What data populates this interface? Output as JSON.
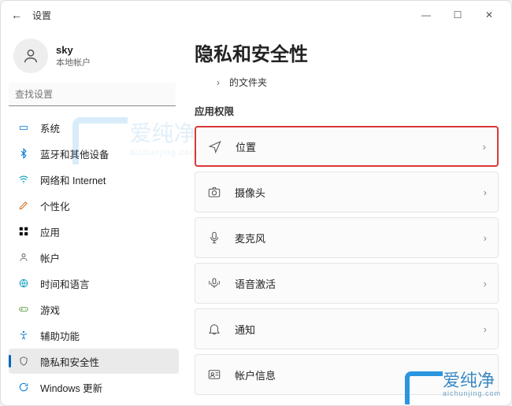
{
  "titlebar": {
    "title": "设置"
  },
  "user": {
    "name": "sky",
    "subtitle": "本地帐户"
  },
  "search": {
    "placeholder": "查找设置"
  },
  "nav": {
    "items": [
      {
        "label": "系统"
      },
      {
        "label": "蓝牙和其他设备"
      },
      {
        "label": "网络和 Internet"
      },
      {
        "label": "个性化"
      },
      {
        "label": "应用"
      },
      {
        "label": "帐户"
      },
      {
        "label": "时间和语言"
      },
      {
        "label": "游戏"
      },
      {
        "label": "辅助功能"
      },
      {
        "label": "隐私和安全性"
      },
      {
        "label": "Windows 更新"
      }
    ]
  },
  "page": {
    "title": "隐私和安全性",
    "folder_line": "的文件夹",
    "section_label": "应用权限",
    "settings": [
      {
        "label": "位置"
      },
      {
        "label": "摄像头"
      },
      {
        "label": "麦克风"
      },
      {
        "label": "语音激活"
      },
      {
        "label": "通知"
      },
      {
        "label": "帐户信息"
      }
    ]
  },
  "watermark": {
    "brand": "爱纯净",
    "domain": "aichunjing.com"
  }
}
